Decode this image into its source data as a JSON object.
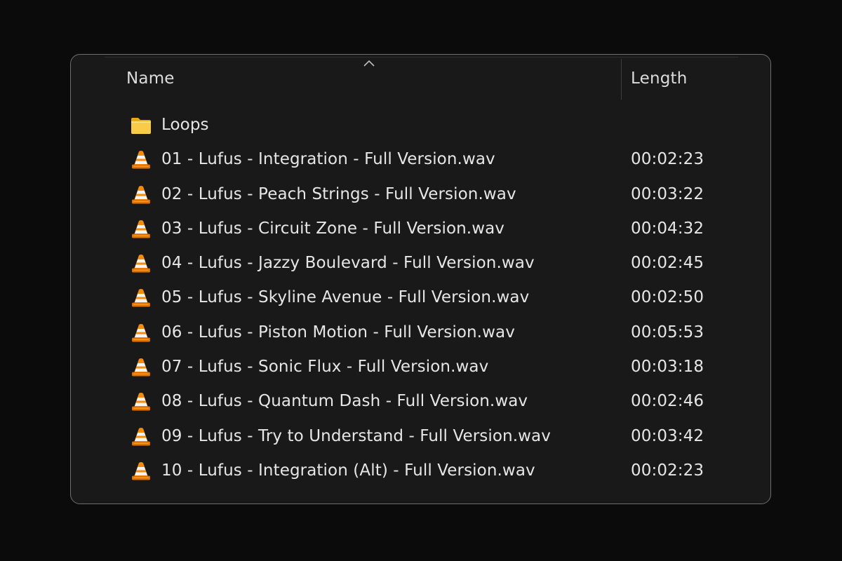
{
  "columns": {
    "name": "Name",
    "length": "Length"
  },
  "sort": {
    "column": "Name",
    "direction": "ascending",
    "indicator_icon": "chevron-up-icon"
  },
  "colors": {
    "window_bg": "#191919",
    "border": "#6e6e6e",
    "text": "#e6e6e6",
    "folder": "#f5c542",
    "vlc_orange": "#f08a00"
  },
  "items": [
    {
      "name": "Loops",
      "length": "",
      "type": "folder",
      "icon": "folder-icon"
    },
    {
      "name": "01 - Lufus - Integration - Full Version.wav",
      "length": "00:02:23",
      "type": "audio",
      "icon": "vlc-cone-icon"
    },
    {
      "name": "02 - Lufus - Peach Strings - Full Version.wav",
      "length": "00:03:22",
      "type": "audio",
      "icon": "vlc-cone-icon"
    },
    {
      "name": "03 - Lufus - Circuit Zone - Full Version.wav",
      "length": "00:04:32",
      "type": "audio",
      "icon": "vlc-cone-icon"
    },
    {
      "name": "04 - Lufus - Jazzy Boulevard - Full Version.wav",
      "length": "00:02:45",
      "type": "audio",
      "icon": "vlc-cone-icon"
    },
    {
      "name": "05 - Lufus - Skyline Avenue - Full Version.wav",
      "length": "00:02:50",
      "type": "audio",
      "icon": "vlc-cone-icon"
    },
    {
      "name": "06 - Lufus - Piston Motion - Full Version.wav",
      "length": "00:05:53",
      "type": "audio",
      "icon": "vlc-cone-icon"
    },
    {
      "name": "07 - Lufus - Sonic Flux - Full Version.wav",
      "length": "00:03:18",
      "type": "audio",
      "icon": "vlc-cone-icon"
    },
    {
      "name": "08 - Lufus - Quantum Dash - Full Version.wav",
      "length": "00:02:46",
      "type": "audio",
      "icon": "vlc-cone-icon"
    },
    {
      "name": "09 - Lufus - Try to Understand - Full Version.wav",
      "length": "00:03:42",
      "type": "audio",
      "icon": "vlc-cone-icon"
    },
    {
      "name": "10 - Lufus - Integration (Alt) - Full Version.wav",
      "length": "00:02:23",
      "type": "audio",
      "icon": "vlc-cone-icon"
    }
  ]
}
